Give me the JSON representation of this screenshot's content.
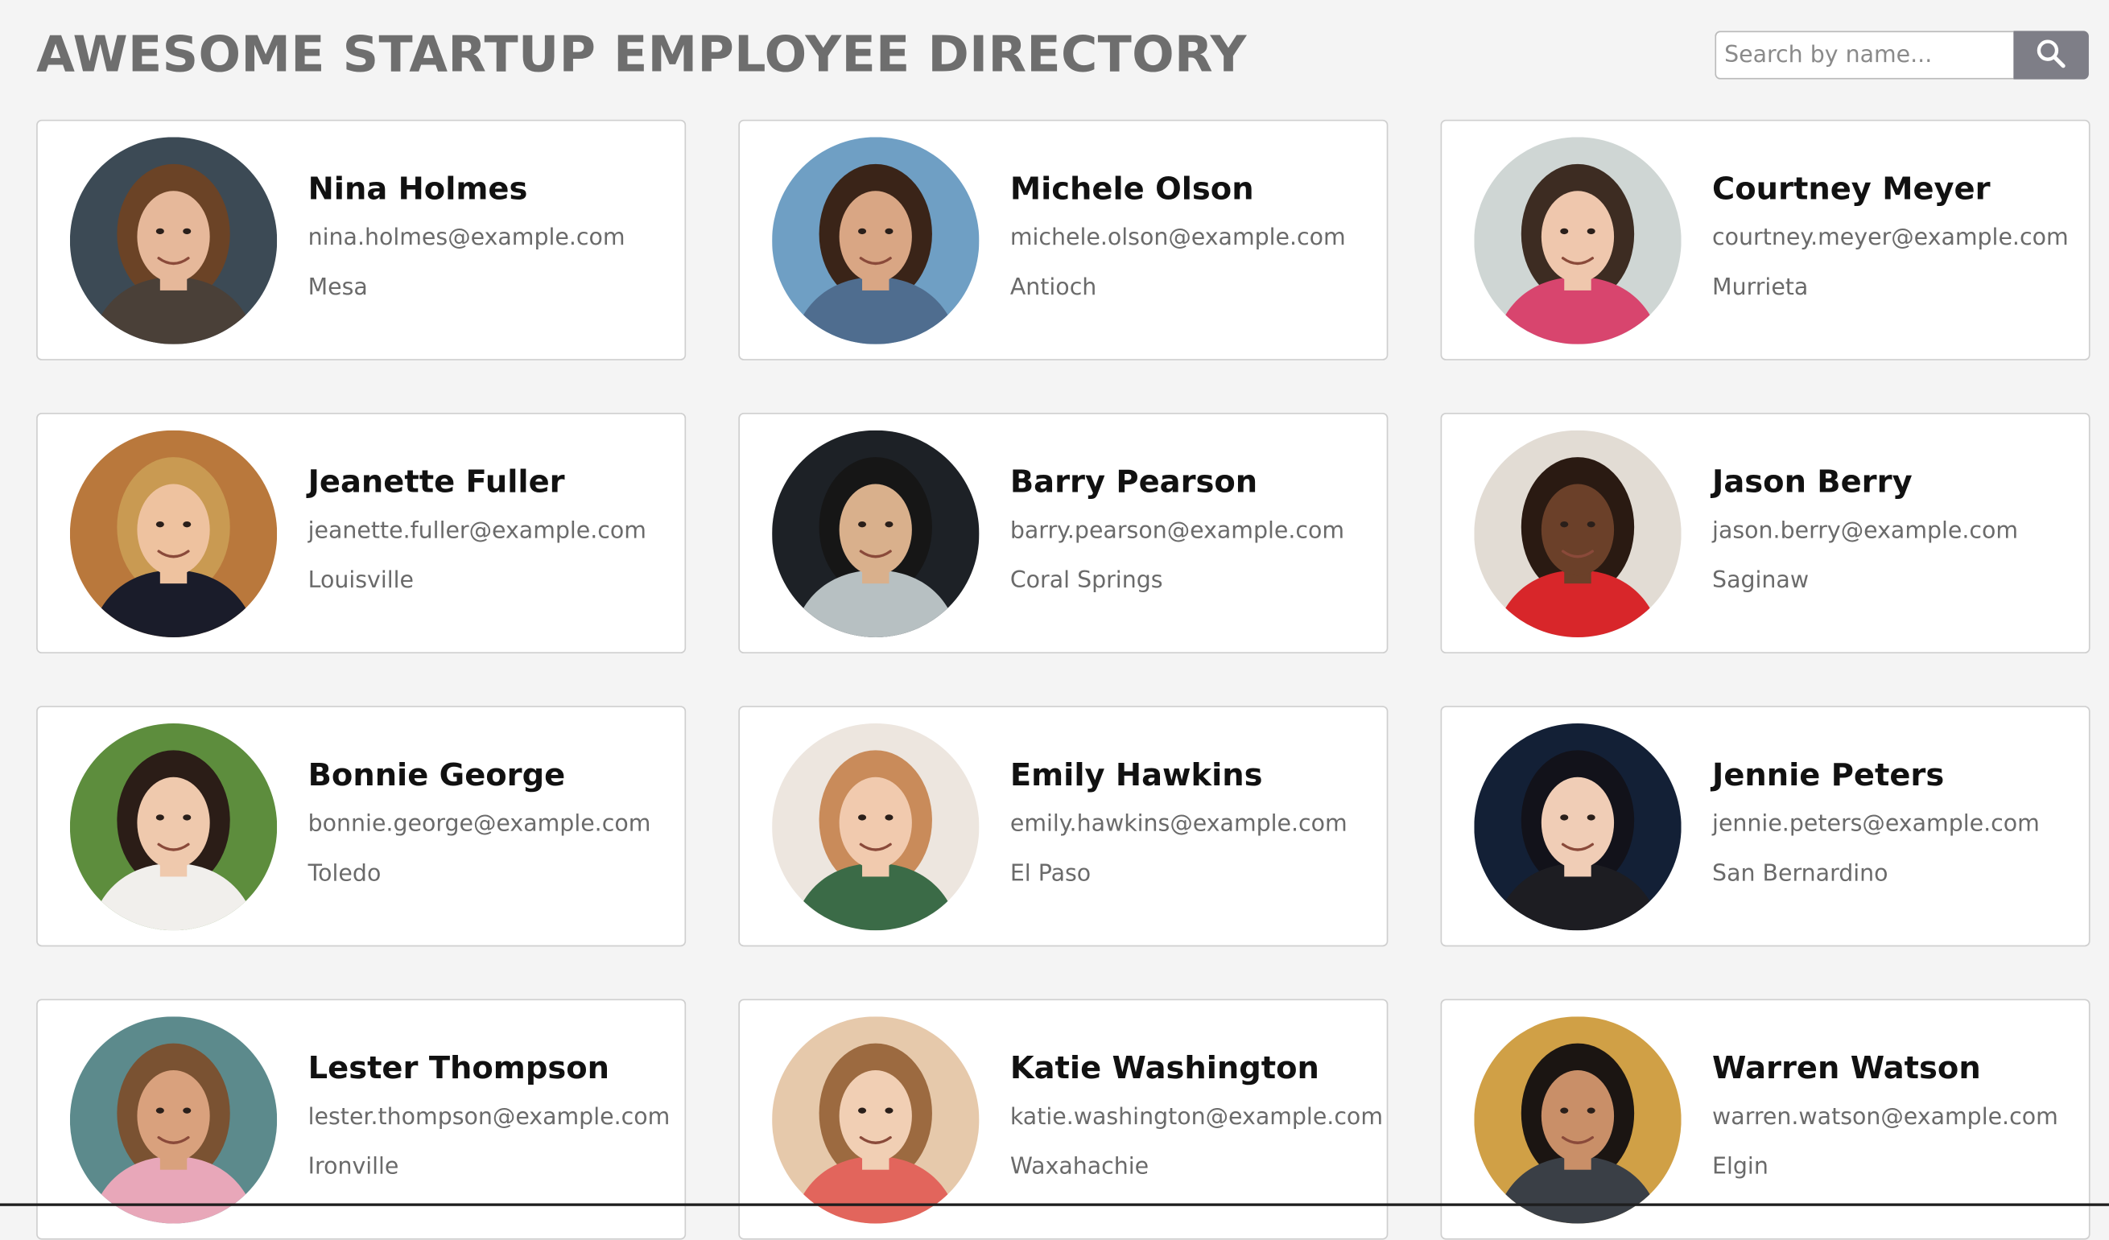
{
  "header": {
    "title": "AWESOME STARTUP EMPLOYEE DIRECTORY",
    "search_placeholder": "Search by name..."
  },
  "employees": [
    {
      "name": "Nina Holmes",
      "email": "nina.holmes@example.com",
      "city": "Mesa",
      "avatar": {
        "bg": "#3c4a55",
        "skin": "#e6b89a",
        "hair": "#6b4326",
        "shirt": "#4a4038"
      }
    },
    {
      "name": "Michele Olson",
      "email": "michele.olson@example.com",
      "city": "Antioch",
      "avatar": {
        "bg": "#6f9fc4",
        "skin": "#d9a684",
        "hair": "#3a2418",
        "shirt": "#4f6d8f"
      }
    },
    {
      "name": "Courtney Meyer",
      "email": "courtney.meyer@example.com",
      "city": "Murrieta",
      "avatar": {
        "bg": "#cfd6d4",
        "skin": "#efc7ad",
        "hair": "#3d2c22",
        "shirt": "#d8456e"
      }
    },
    {
      "name": "Jeanette Fuller",
      "email": "jeanette.fuller@example.com",
      "city": "Louisville",
      "avatar": {
        "bg": "#b9783c",
        "skin": "#eec29f",
        "hair": "#c99a52",
        "shirt": "#1a1c2a"
      }
    },
    {
      "name": "Barry Pearson",
      "email": "barry.pearson@example.com",
      "city": "Coral Springs",
      "avatar": {
        "bg": "#1d2126",
        "skin": "#d9b08c",
        "hair": "#161616",
        "shirt": "#b7c0c2"
      }
    },
    {
      "name": "Jason Berry",
      "email": "jason.berry@example.com",
      "city": "Saginaw",
      "avatar": {
        "bg": "#e2dcd4",
        "skin": "#6b4029",
        "hair": "#2a1a12",
        "shirt": "#d8262a"
      }
    },
    {
      "name": "Bonnie George",
      "email": "bonnie.george@example.com",
      "city": "Toledo",
      "avatar": {
        "bg": "#5d8d3d",
        "skin": "#efc9ad",
        "hair": "#2b1d17",
        "shirt": "#f1efec"
      }
    },
    {
      "name": "Emily Hawkins",
      "email": "emily.hawkins@example.com",
      "city": "El Paso",
      "avatar": {
        "bg": "#ede6df",
        "skin": "#f1caae",
        "hair": "#c98b5a",
        "shirt": "#3b6b47"
      }
    },
    {
      "name": "Jennie Peters",
      "email": "jennie.peters@example.com",
      "city": "San Bernardino",
      "avatar": {
        "bg": "#132036",
        "skin": "#f0cdb6",
        "hair": "#12121a",
        "shirt": "#1d1d22"
      }
    },
    {
      "name": "Lester Thompson",
      "email": "lester.thompson@example.com",
      "city": "Ironville",
      "avatar": {
        "bg": "#5c8a8c",
        "skin": "#d9a17d",
        "hair": "#7a5232",
        "shirt": "#e8a7b9"
      }
    },
    {
      "name": "Katie Washington",
      "email": "katie.washington@example.com",
      "city": "Waxahachie",
      "avatar": {
        "bg": "#e6c9ab",
        "skin": "#f1cfb4",
        "hair": "#9c6a40",
        "shirt": "#e2655c"
      }
    },
    {
      "name": "Warren Watson",
      "email": "warren.watson@example.com",
      "city": "Elgin",
      "avatar": {
        "bg": "#d0a046",
        "skin": "#c98f68",
        "hair": "#1b1512",
        "shirt": "#3a3f46"
      }
    }
  ]
}
